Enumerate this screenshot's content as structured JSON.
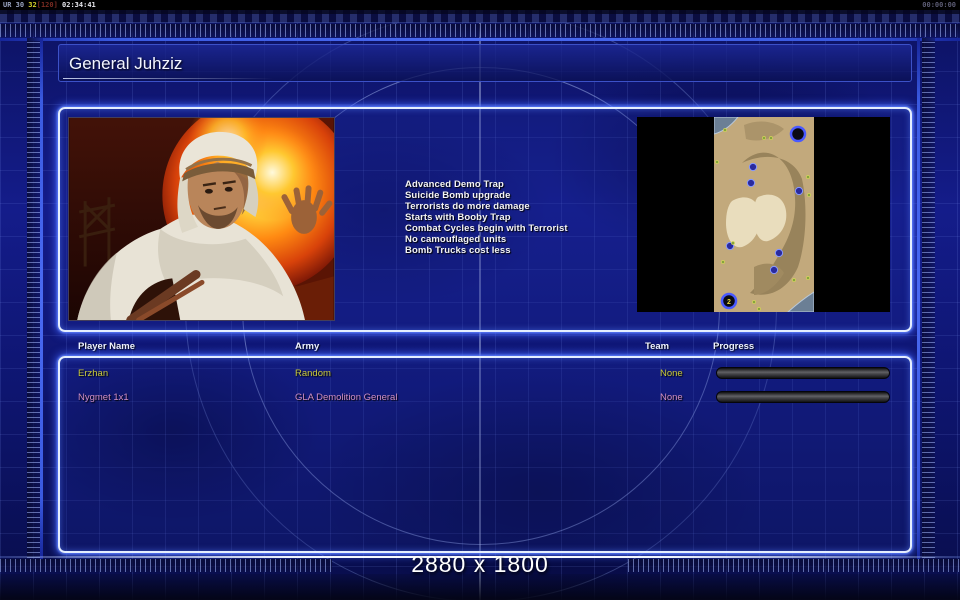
{
  "topbar": {
    "debug": {
      "ur": "UR 30 ",
      "fps": "32",
      "bracket": "[120]",
      "time": " 02:34:41"
    },
    "clock": "00:00:00"
  },
  "header": {
    "title": "General Juhziz"
  },
  "abilities": [
    "Advanced Demo Trap",
    "Suicide Bomb upgrade",
    "Terrorists do more damage",
    "Starts with Booby Trap",
    "Combat Cycles begin with Terrorist",
    "No camouflaged units",
    "Bomb Trucks cost less"
  ],
  "map_preview": {
    "start_label": "2"
  },
  "players": {
    "columns": [
      "Player Name",
      "Army",
      "Team",
      "Progress"
    ],
    "rows": [
      {
        "name": "Erzhan",
        "army": "Random",
        "team": "None",
        "color": "#c9c93a",
        "progress": 0
      },
      {
        "name": "Nygmet 1x1",
        "army": "GLA Demolition General",
        "team": "None",
        "color": "#cf8fc4",
        "progress": 0
      }
    ]
  },
  "footer": {
    "resolution": "2880 x 1800"
  },
  "colors": {
    "frame_accent": "#3a5ae0",
    "panel_glow": "#4060ff",
    "player1_text": "#c9c93a",
    "player2_text": "#cf8fc4",
    "header_text": "#f5f8ff",
    "map_sand": "#c2a97c",
    "map_dark_sand": "#98835b",
    "map_light_sand": "#e9ddbd",
    "map_water": "#6b7f95"
  }
}
